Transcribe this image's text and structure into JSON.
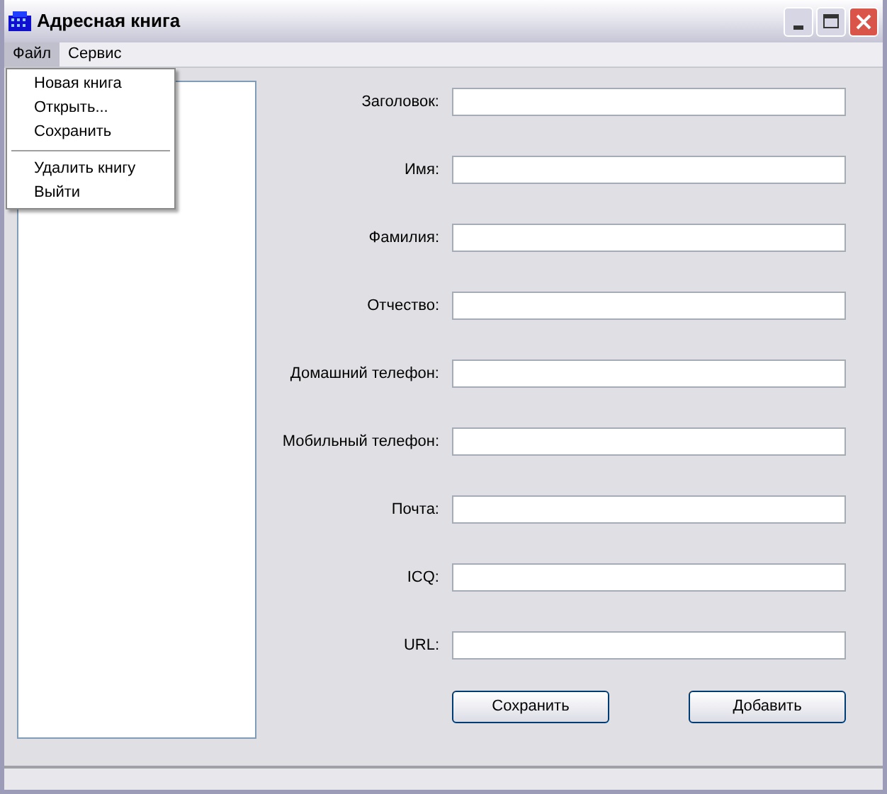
{
  "window": {
    "title": "Адресная книга"
  },
  "menu_bar": [
    {
      "label": "Файл",
      "selected": true
    },
    {
      "label": "Сервис",
      "selected": false
    }
  ],
  "open_menu": {
    "items": [
      {
        "kind": "item",
        "label": "Новая книга"
      },
      {
        "kind": "item",
        "label": "Открыть..."
      },
      {
        "kind": "item",
        "label": "Сохранить"
      },
      {
        "kind": "separator"
      },
      {
        "kind": "item",
        "label": "Удалить книгу"
      },
      {
        "kind": "item",
        "label": "Выйти"
      }
    ]
  },
  "form": {
    "fields": [
      {
        "label": "Заголовок:"
      },
      {
        "label": "Имя:"
      },
      {
        "label": "Фамилия:"
      },
      {
        "label": "Отчество:"
      },
      {
        "label": "Домашний телефон:"
      },
      {
        "label": "Мобильный телефон:"
      },
      {
        "label": "Почта:"
      },
      {
        "label": "ICQ:"
      },
      {
        "label": "URL:"
      }
    ],
    "buttons": [
      "Сохранить",
      "Добавить"
    ]
  }
}
